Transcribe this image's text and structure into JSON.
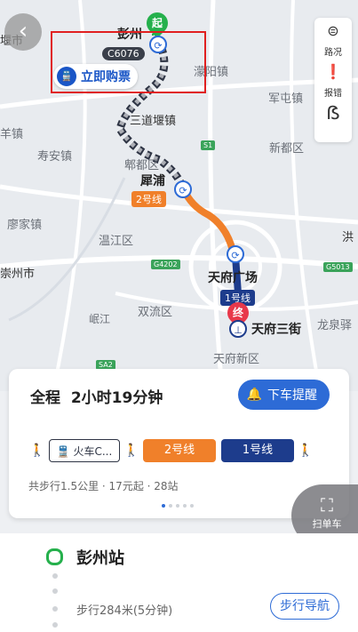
{
  "map": {
    "places": [
      "彭州",
      "濛阳镇",
      "军屯镇",
      "三道堰镇",
      "新都区",
      "寿安镇",
      "郫都区",
      "犀浦",
      "廖家镇",
      "温江区",
      "双流区",
      "天府新区",
      "龙泉驿",
      "岷江",
      "洪",
      "堰市",
      "羊镇",
      "崇州市",
      "天府广场",
      "天府三街"
    ],
    "shields": [
      "S1",
      "G4202",
      "G5013",
      "SA2"
    ],
    "train_tag": "C6076",
    "buy_ticket": "立即购票",
    "start_mark": "起",
    "end_mark": "终",
    "line2_tag": "2号线",
    "line1_tag": "1号线"
  },
  "toolbar": {
    "traffic": "路况",
    "report": "报错",
    "people_icon": "人"
  },
  "card": {
    "total_label": "全程",
    "total_time": "2小时19分钟",
    "remind": "下车提醒",
    "segments": [
      "火车C...",
      "2号线",
      "1号线"
    ],
    "walk": "共步行1.5公里",
    "price": "17元起",
    "stops": "28站",
    "colors": {
      "blue": "#2d6bd6",
      "line2": "#f0802a",
      "line1": "#1d3c8c",
      "start": "#25b04c",
      "end": "#e8384a"
    }
  },
  "scan": "扫单车",
  "route": {
    "first_station": "彭州站",
    "walk_info": "步行284米(5分钟)",
    "nav": "步行导航"
  }
}
